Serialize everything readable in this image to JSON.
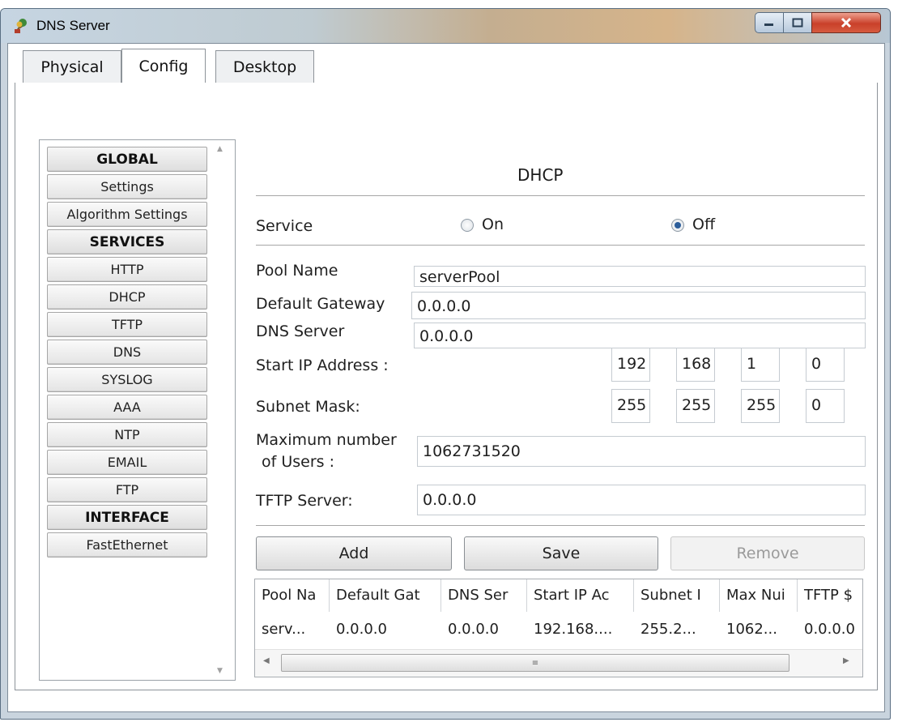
{
  "window": {
    "title": "DNS Server"
  },
  "tabs": [
    {
      "label": "Physical"
    },
    {
      "label": "Config"
    },
    {
      "label": "Desktop"
    }
  ],
  "sidebar": {
    "items": [
      {
        "label": "GLOBAL",
        "header": true
      },
      {
        "label": "Settings"
      },
      {
        "label": "Algorithm Settings"
      },
      {
        "label": "SERVICES",
        "header": true
      },
      {
        "label": "HTTP"
      },
      {
        "label": "DHCP"
      },
      {
        "label": "TFTP"
      },
      {
        "label": "DNS"
      },
      {
        "label": "SYSLOG"
      },
      {
        "label": "AAA"
      },
      {
        "label": "NTP"
      },
      {
        "label": "EMAIL"
      },
      {
        "label": "FTP"
      },
      {
        "label": "INTERFACE",
        "header": true
      },
      {
        "label": "FastEthernet"
      }
    ]
  },
  "dhcp": {
    "title": "DHCP",
    "service_label": "Service",
    "on_label": "On",
    "off_label": "Off",
    "selected": "Off",
    "pool_name_label": "Pool Name",
    "pool_name": "serverPool",
    "gateway_label": "Default Gateway",
    "gateway": "0.0.0.0",
    "dns_label": "DNS Server",
    "dns": "0.0.0.0",
    "start_ip_label": "Start IP Address :",
    "start_ip": [
      "192",
      "168",
      "1",
      "0"
    ],
    "subnet_label": "Subnet Mask:",
    "subnet": [
      "255",
      "255",
      "255",
      "0"
    ],
    "max_users_label_1": "Maximum number",
    "max_users_label_2": "of Users :",
    "max_users": "1062731520",
    "tftp_label": "TFTP Server:",
    "tftp": "0.0.0.0",
    "add_label": "Add",
    "save_label": "Save",
    "remove_label": "Remove"
  },
  "table": {
    "columns": [
      "Pool Na",
      "Default Gat",
      "DNS Ser",
      "Start IP Ac",
      "Subnet I",
      "Max Nui",
      "TFTP $"
    ],
    "rows": [
      [
        "serv...",
        "0.0.0.0",
        "0.0.0.0",
        "192.168....",
        "255.2...",
        "1062...",
        "0.0.0.0"
      ]
    ]
  }
}
